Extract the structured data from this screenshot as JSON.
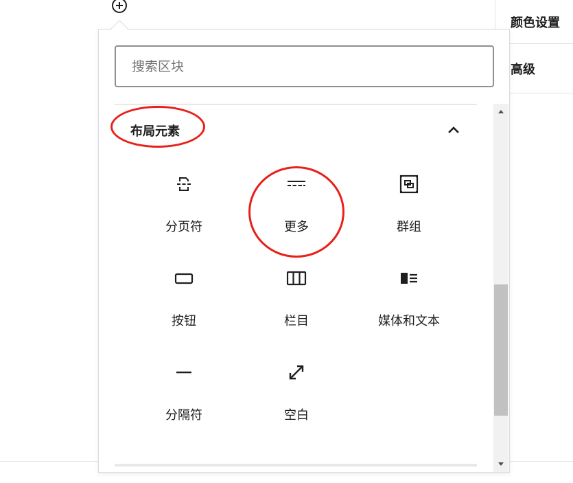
{
  "add_block_icon": "plus-circle-icon",
  "settings_panel": {
    "items": [
      {
        "label": "颜色设置"
      },
      {
        "label": "高级"
      }
    ]
  },
  "inserter": {
    "search": {
      "placeholder": "搜索区块",
      "value": ""
    },
    "category": {
      "title": "布局元素",
      "collapse_icon": "chevron-up-icon"
    },
    "blocks": [
      {
        "label": "分页符",
        "icon": "page-break-icon"
      },
      {
        "label": "更多",
        "icon": "more-icon"
      },
      {
        "label": "群组",
        "icon": "group-icon"
      },
      {
        "label": "按钮",
        "icon": "button-icon"
      },
      {
        "label": "栏目",
        "icon": "columns-icon"
      },
      {
        "label": "媒体和文本",
        "icon": "media-text-icon"
      },
      {
        "label": "分隔符",
        "icon": "separator-icon"
      },
      {
        "label": "空白",
        "icon": "spacer-icon"
      }
    ]
  },
  "colors": {
    "annotation": "#e8201a",
    "icon": "#1e1e1e",
    "border": "#8c8f94"
  }
}
